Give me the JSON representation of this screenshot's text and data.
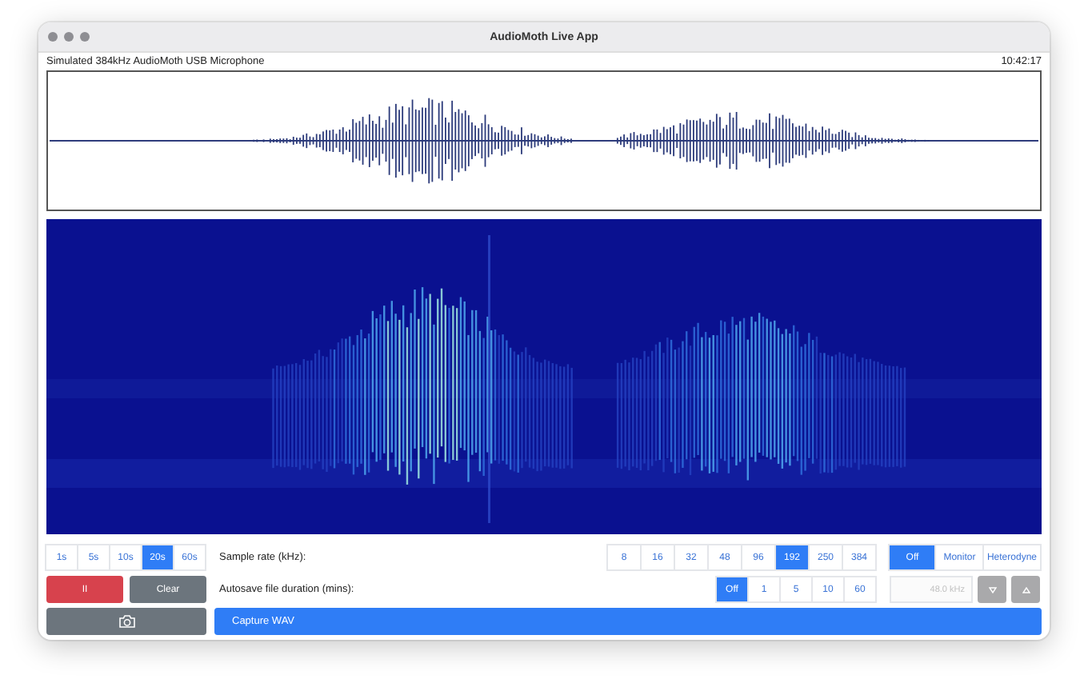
{
  "window": {
    "title": "AudioMoth Live App"
  },
  "device": "Simulated 384kHz AudioMoth USB Microphone",
  "clock": "10:42:17",
  "time_spans": [
    {
      "label": "1s",
      "selected": false
    },
    {
      "label": "5s",
      "selected": false
    },
    {
      "label": "10s",
      "selected": false
    },
    {
      "label": "20s",
      "selected": true
    },
    {
      "label": "60s",
      "selected": false
    }
  ],
  "pause_button": "II",
  "clear_button": "Clear",
  "sample_rate": {
    "label": "Sample rate (kHz):",
    "options": [
      {
        "label": "8",
        "selected": false
      },
      {
        "label": "16",
        "selected": false
      },
      {
        "label": "32",
        "selected": false
      },
      {
        "label": "48",
        "selected": false
      },
      {
        "label": "96",
        "selected": false
      },
      {
        "label": "192",
        "selected": true
      },
      {
        "label": "250",
        "selected": false
      },
      {
        "label": "384",
        "selected": false
      }
    ]
  },
  "monitor_modes": [
    {
      "label": "Off",
      "selected": true
    },
    {
      "label": "Monitor",
      "selected": false
    },
    {
      "label": "Heterodyne",
      "selected": false
    }
  ],
  "autosave": {
    "label": "Autosave file duration (mins):",
    "options": [
      {
        "label": "Off",
        "selected": true
      },
      {
        "label": "1",
        "selected": false
      },
      {
        "label": "5",
        "selected": false
      },
      {
        "label": "10",
        "selected": false
      },
      {
        "label": "60",
        "selected": false
      }
    ]
  },
  "heterodyne_frequency": {
    "placeholder": "48.0 kHz",
    "disabled": true
  },
  "capture_button": "Capture WAV"
}
